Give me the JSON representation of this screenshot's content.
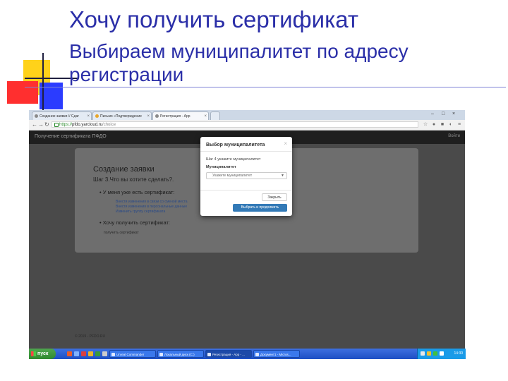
{
  "slide": {
    "title": "Хочу получить сертификат",
    "subtitle": "Выбираем муниципалитет по адресу регистрации"
  },
  "browser": {
    "tabs": [
      {
        "label": "Создание заявки // Сдаг",
        "icon_color": "#8a8a8a",
        "active": false
      },
      {
        "label": "Письмо «Подтверждение",
        "icon_color": "#e8a62a",
        "active": false
      },
      {
        "label": "Регистрация - App",
        "icon_color": "#8a8a8a",
        "active": true
      }
    ],
    "url": {
      "scheme": "https://",
      "host": "pfdo.yarcloud.ru",
      "path": "/choice"
    }
  },
  "site": {
    "brand": "Получение сертификата ПФДО",
    "login": "Войти",
    "heading": "Создание заявки",
    "step": "Шаг 3.Что вы хотите сделать?.",
    "option1": "У меня уже есть сертификат:",
    "option1_links": [
      "Внести изменения в связи со сменой места",
      "Внести изменения в персональные данные",
      "Изменить группу сертификата"
    ],
    "option2": "Хочу получить сертификат:",
    "option2_sub": "получить сертификат",
    "footer": "© 2019 - PFDO.RU"
  },
  "modal": {
    "title": "Выбор муниципалитета",
    "close_x": "×",
    "step": "Шаг 4 укажите муниципалитет",
    "label": "Муниципалитет",
    "select_placeholder": "Укажите муниципалитет",
    "close_button": "Закрыть",
    "submit_button": "Выбрать и продолжить"
  },
  "taskbar": {
    "start_label": "пуск",
    "tasks": [
      {
        "label": "Unreal Commander",
        "active": false
      },
      {
        "label": "Локальный диск (C:)",
        "active": false
      },
      {
        "label": "Регистрация - App - ...",
        "active": true
      },
      {
        "label": "Документ1 - Micros...",
        "active": false
      }
    ],
    "clock": "14:30"
  },
  "colors": {
    "slide_title": "#2b2fa8",
    "modal_submit": "#337ab7",
    "site_nav": "#1f1f1f"
  }
}
